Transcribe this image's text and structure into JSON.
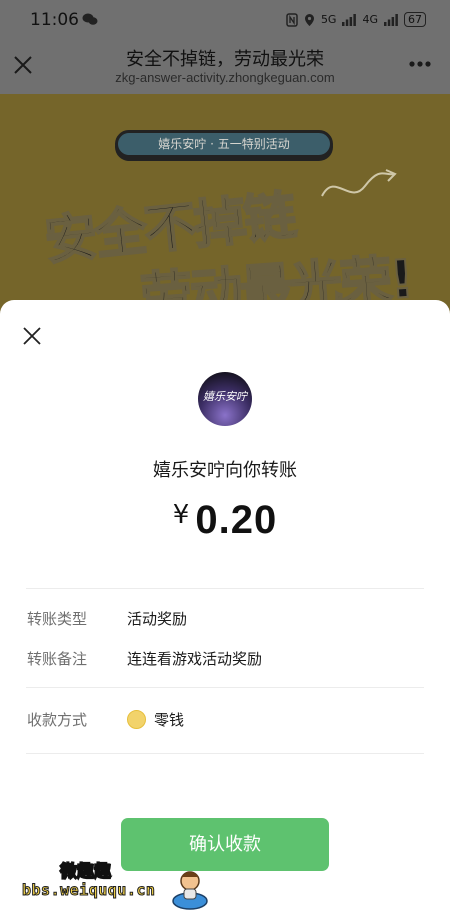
{
  "status_bar": {
    "time": "11:06",
    "signal_5g": "5G",
    "signal_4g": "4G",
    "battery": "67"
  },
  "title_bar": {
    "title": "安全不掉链，劳动最光荣",
    "url": "zkg-answer-activity.zhongkeguan.com"
  },
  "banner": {
    "pill_text": "嬉乐安咛 · 五一特别活动",
    "headline_line1": "安全不掉链",
    "headline_line2": "劳动最光荣!"
  },
  "transfer": {
    "avatar_text": "嬉乐安咛",
    "sender_line": "嬉乐安咛向你转账",
    "currency": "¥",
    "amount": "0.20",
    "rows": [
      {
        "label": "转账类型",
        "value": "活动奖励"
      },
      {
        "label": "转账备注",
        "value": "连连看游戏活动奖励"
      },
      {
        "label": "收款方式",
        "value": "零钱"
      }
    ],
    "confirm_label": "确认收款"
  },
  "watermark": {
    "top": "微趣趣",
    "url": "bbs.weiququ.cn"
  },
  "colors": {
    "accent_green": "#5ec26f",
    "overlay": "#707070",
    "banner": "#75652a"
  }
}
